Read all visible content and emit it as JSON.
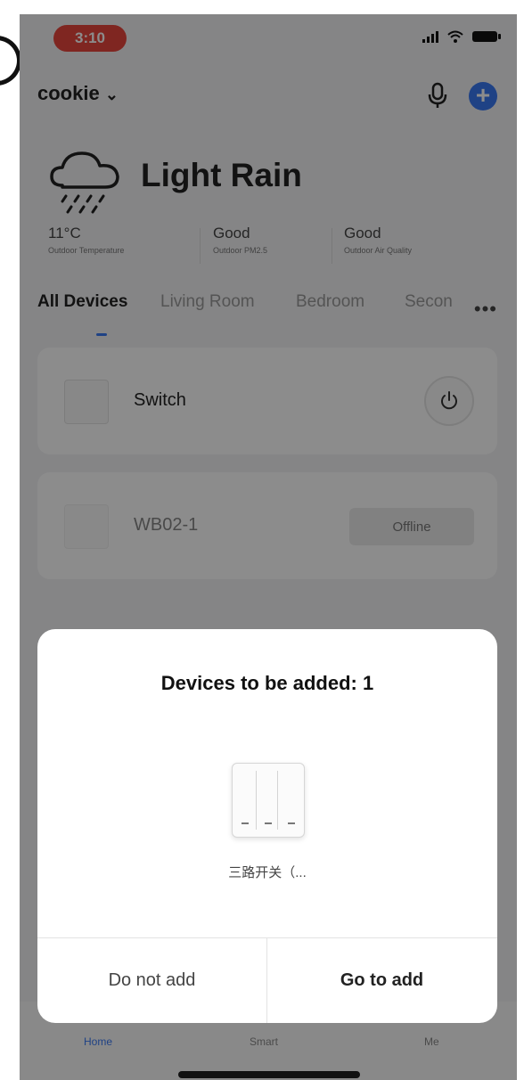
{
  "status_bar": {
    "time": "3:10"
  },
  "header": {
    "home_name": "cookie",
    "chevron": "⌄",
    "add_icon": "+"
  },
  "weather": {
    "condition": "Light Rain",
    "stats": [
      {
        "value": "11°C",
        "label": "Outdoor Temperature"
      },
      {
        "value": "Good",
        "label": "Outdoor PM2.5"
      },
      {
        "value": "Good",
        "label": "Outdoor Air Quality"
      }
    ]
  },
  "tabs": {
    "items": [
      "All Devices",
      "Living Room",
      "Bedroom",
      "Secon"
    ],
    "active": "All Devices",
    "more": "•••"
  },
  "devices": [
    {
      "name": "Switch",
      "status": "online"
    },
    {
      "name": "WB02-1",
      "status": "Offline"
    }
  ],
  "bottom_nav": {
    "items": [
      "Home",
      "Smart",
      "Me"
    ]
  },
  "dialog": {
    "title": "Devices to be added: 1",
    "device_name": "三路开关（...",
    "cancel_label": "Do not add",
    "confirm_label": "Go to add"
  },
  "colors": {
    "accent": "#3a78f2",
    "time_pill": "#e8453c",
    "overlay": "rgba(0,0,0,0.45)"
  }
}
